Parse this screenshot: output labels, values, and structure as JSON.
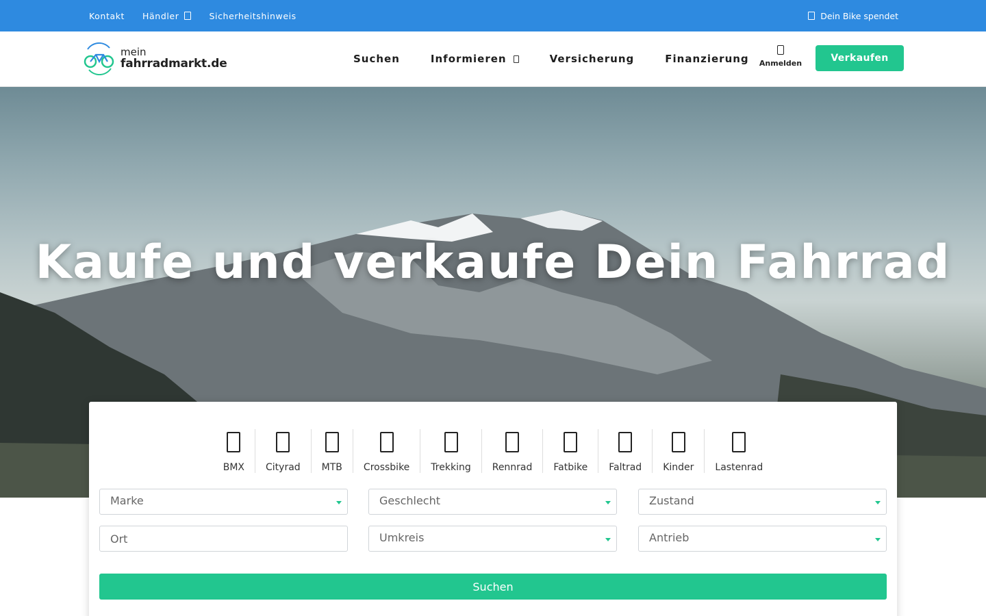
{
  "topbar": {
    "links": [
      "Kontakt",
      "Händler",
      "Sicherheitshinweis"
    ],
    "donate": "Dein Bike spendet"
  },
  "header": {
    "logo_line1": "mein",
    "logo_line2": "fahrradmarkt.de",
    "nav": [
      "Suchen",
      "Informieren",
      "Versicherung",
      "Finanzierung"
    ],
    "login_label": "Anmelden",
    "sell_label": "Verkaufen"
  },
  "hero": {
    "title": "Kaufe und verkaufe Dein Fahrrad"
  },
  "search": {
    "categories": [
      "BMX",
      "Cityrad",
      "MTB",
      "Crossbike",
      "Trekking",
      "Rennrad",
      "Fatbike",
      "Faltrad",
      "Kinder",
      "Lastenrad"
    ],
    "marke": "Marke",
    "geschlecht": "Geschlecht",
    "zustand": "Zustand",
    "ort": "Ort",
    "umkreis": "Umkreis",
    "antrieb": "Antrieb",
    "button": "Suchen"
  },
  "colors": {
    "topbar": "#2e8ae0",
    "accent": "#22c68f"
  }
}
